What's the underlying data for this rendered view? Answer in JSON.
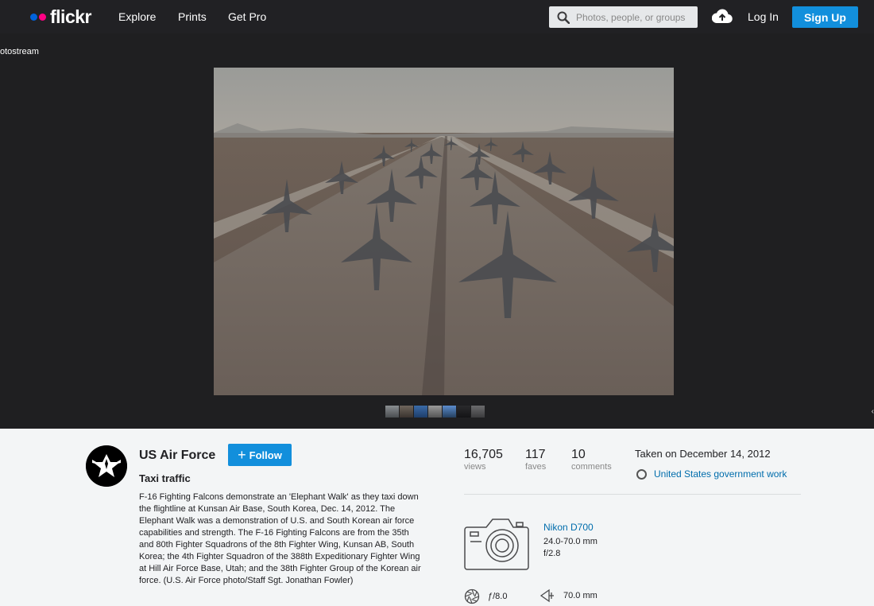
{
  "nav": {
    "logo": "flickr",
    "links": [
      "Explore",
      "Prints",
      "Get Pro"
    ],
    "search_placeholder": "Photos, people, or groups",
    "login": "Log In",
    "signup": "Sign Up"
  },
  "photo_page": {
    "back_link": "otostream"
  },
  "owner": {
    "name": "US Air Force",
    "follow_label": "Follow"
  },
  "photo": {
    "title": "Taxi traffic",
    "description": "F-16 Fighting Falcons demonstrate an 'Elephant Walk' as they taxi down the flightline at Kunsan Air Base, South Korea, Dec. 14, 2012. The Elephant Walk was a demonstration of U.S. and South Korean air force capabilities and strength. The F-16 Fighting Falcons are from the 35th and 80th Fighter Squadrons of the 8th Fighter Wing, Kunsan AB, South Korea; the 4th Fighter Squadron of the 388th Expeditionary Fighter Wing at Hill Air Force Base, Utah; and the 38th Fighter Group of the Korean air force. (U.S. Air Force photo/Staff Sgt. Jonathan Fowler)"
  },
  "stats": {
    "views": {
      "num": "16,705",
      "label": "views"
    },
    "faves": {
      "num": "117",
      "label": "faves"
    },
    "comments": {
      "num": "10",
      "label": "comments"
    }
  },
  "taken": "Taken on December 14, 2012",
  "license": "United States government work",
  "camera": {
    "name": "Nikon D700",
    "lens": "24.0-70.0 mm",
    "max_aperture": "f/2.8",
    "aperture": "ƒ/8.0",
    "focal_length": "70.0 mm"
  },
  "colors": {
    "nav_bg": "#212124",
    "photo_bg": "#1f1f21",
    "accent_blue": "#128fdc",
    "link_blue": "#006dac",
    "logo_blue": "#0063dc",
    "logo_pink": "#ff0084"
  }
}
